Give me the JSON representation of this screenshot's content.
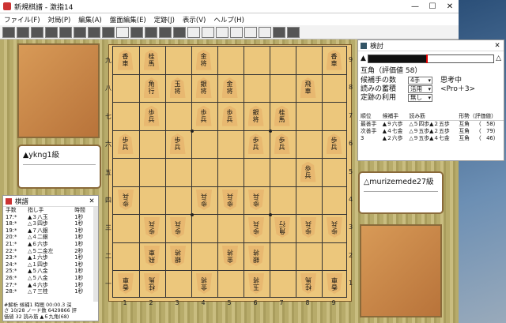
{
  "window": {
    "title": "新規棋譜 - 激指14",
    "controls": [
      "—",
      "☐",
      "✕"
    ]
  },
  "menu": [
    "ファイル(F)",
    "対局(P)",
    "編集(A)",
    "盤面編集(E)",
    "定跡(J)",
    "表示(V)",
    "ヘルプ(H)"
  ],
  "players": {
    "sente": "▲ykng1級",
    "gote": "△murizemede27級"
  },
  "board": {
    "files": [
      "9",
      "8",
      "7",
      "6",
      "5",
      "4",
      "3",
      "2",
      "1"
    ],
    "files_bottom": [
      "1",
      "2",
      "3",
      "4",
      "5",
      "6",
      "7",
      "8",
      "9"
    ],
    "ranks": [
      "九",
      "八",
      "七",
      "六",
      "五",
      "四",
      "三",
      "二",
      "一"
    ],
    "pieces": [
      {
        "f": 0,
        "r": 0,
        "t": "香車",
        "o": "gote"
      },
      {
        "f": 1,
        "r": 0,
        "t": "桂馬",
        "o": "gote"
      },
      {
        "f": 3,
        "r": 0,
        "t": "金将",
        "o": "gote"
      },
      {
        "f": 5,
        "r": 0,
        "t": "玉将",
        "o": "gote"
      },
      {
        "f": 7,
        "r": 0,
        "t": "桂馬",
        "o": "gote"
      },
      {
        "f": 8,
        "r": 0,
        "t": "香車",
        "o": "gote"
      },
      {
        "f": 1,
        "r": 1,
        "t": "飛車",
        "o": "gote"
      },
      {
        "f": 2,
        "r": 1,
        "t": "銀将",
        "o": "gote"
      },
      {
        "f": 4,
        "r": 1,
        "t": "金将",
        "o": "gote"
      },
      {
        "f": 5,
        "r": 1,
        "t": "銀将",
        "o": "gote"
      },
      {
        "f": 1,
        "r": 2,
        "t": "歩兵",
        "o": "gote"
      },
      {
        "f": 2,
        "r": 2,
        "t": "歩兵",
        "o": "gote"
      },
      {
        "f": 5,
        "r": 2,
        "t": "歩兵",
        "o": "gote"
      },
      {
        "f": 6,
        "r": 2,
        "t": "角行",
        "o": "gote"
      },
      {
        "f": 7,
        "r": 2,
        "t": "歩兵",
        "o": "gote"
      },
      {
        "f": 8,
        "r": 2,
        "t": "歩兵",
        "o": "gote"
      },
      {
        "f": 0,
        "r": 3,
        "t": "歩兵",
        "o": "gote"
      },
      {
        "f": 3,
        "r": 3,
        "t": "歩兵",
        "o": "gote"
      },
      {
        "f": 4,
        "r": 3,
        "t": "歩兵",
        "o": "gote"
      },
      {
        "f": 5,
        "r": 3,
        "t": "歩兵",
        "o": "gote"
      },
      {
        "f": 7,
        "r": 4,
        "t": "歩兵",
        "o": "sente"
      },
      {
        "f": 0,
        "r": 5,
        "t": "歩兵",
        "o": "sente"
      },
      {
        "f": 2,
        "r": 5,
        "t": "歩兵",
        "o": "sente"
      },
      {
        "f": 5,
        "r": 5,
        "t": "歩兵",
        "o": "sente"
      },
      {
        "f": 6,
        "r": 5,
        "t": "歩兵",
        "o": "sente"
      },
      {
        "f": 8,
        "r": 5,
        "t": "歩兵",
        "o": "sente"
      },
      {
        "f": 1,
        "r": 6,
        "t": "歩兵",
        "o": "sente"
      },
      {
        "f": 3,
        "r": 6,
        "t": "歩兵",
        "o": "sente"
      },
      {
        "f": 4,
        "r": 6,
        "t": "歩兵",
        "o": "sente"
      },
      {
        "f": 5,
        "r": 6,
        "t": "銀将",
        "o": "sente"
      },
      {
        "f": 6,
        "r": 6,
        "t": "桂馬",
        "o": "sente"
      },
      {
        "f": 1,
        "r": 7,
        "t": "角行",
        "o": "sente"
      },
      {
        "f": 2,
        "r": 7,
        "t": "玉将",
        "o": "sente"
      },
      {
        "f": 3,
        "r": 7,
        "t": "銀将",
        "o": "sente"
      },
      {
        "f": 4,
        "r": 7,
        "t": "金将",
        "o": "sente"
      },
      {
        "f": 7,
        "r": 7,
        "t": "飛車",
        "o": "sente"
      },
      {
        "f": 0,
        "r": 8,
        "t": "香車",
        "o": "sente"
      },
      {
        "f": 1,
        "r": 8,
        "t": "桂馬",
        "o": "sente"
      },
      {
        "f": 3,
        "r": 8,
        "t": "金将",
        "o": "sente"
      },
      {
        "f": 8,
        "r": 8,
        "t": "香車",
        "o": "sente"
      }
    ]
  },
  "analysis": {
    "title": "検討",
    "sente_mark": "▲",
    "gote_mark": "△",
    "eval_fraction": 0.46,
    "status": "互角（評価値 58）",
    "options": [
      {
        "label": "候補手の数",
        "value": "4手"
      },
      {
        "label": "読みの蓄積",
        "value": "活用"
      },
      {
        "label": "定跡の利用",
        "value": "無し"
      }
    ],
    "thinking": "思考中",
    "engine": "<Pro＋3>",
    "headers": [
      "順位",
      "候補手",
      "読み筋",
      "形勢（評価値）"
    ],
    "rows": [
      [
        "最善手",
        "▲９六歩",
        "△５四歩▲２五歩",
        "互角",
        "（",
        "58）"
      ],
      [
        "次善手",
        "▲４七金",
        "△９五歩▲２五歩",
        "互角",
        "（",
        "79）"
      ],
      [
        "3",
        "▲２六歩",
        "△９五歩▲４七金",
        "互角",
        "（",
        "46）"
      ]
    ]
  },
  "kifu": {
    "title": "棋譜",
    "headers": [
      "手数",
      "指し手",
      "時間"
    ],
    "rows": [
      [
        "17:*",
        "▲３八玉",
        "1秒"
      ],
      [
        "18:*",
        "△３四歩",
        "1秒"
      ],
      [
        "19:*",
        "▲７八銀",
        "1秒"
      ],
      [
        "20:*",
        "△４二銀",
        "1秒"
      ],
      [
        "21:*",
        "▲６六歩",
        "1秒"
      ],
      [
        "22:*",
        "△５二金左",
        "2秒"
      ],
      [
        "23:*",
        "▲１六歩",
        "1秒"
      ],
      [
        "24:*",
        "△１四歩",
        "1秒"
      ],
      [
        "25:*",
        "▲５八金",
        "1秒"
      ],
      [
        "26:*",
        "△５八金",
        "1秒"
      ],
      [
        "27:*",
        "▲４六歩",
        "1秒"
      ],
      [
        "28:*",
        "△７三桂",
        "1秒"
      ]
    ],
    "status": [
      "#解析 候補1 時間 00:00.3 深",
      "さ 10/28 ノード数 6429866 評",
      "価値 32 読み筋 ▲６九角(68)"
    ]
  }
}
